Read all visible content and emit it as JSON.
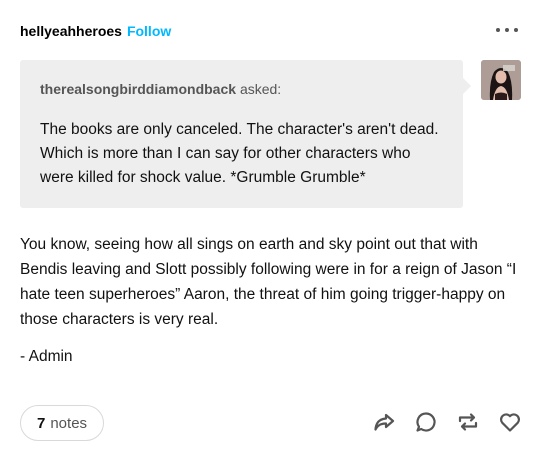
{
  "post": {
    "blog_name": "hellyeahheroes",
    "follow_label": "Follow",
    "more_icon": "more-horizontal-icon"
  },
  "ask": {
    "asker": "therealsongbirddiamondback",
    "asked_label": "asked:",
    "question": "The books are only canceled.  The character's aren't dead.  Which is more than I can say for other characters who were killed for shock value. *Grumble Grumble*"
  },
  "answer": {
    "body": "You know, seeing how all sings on earth and sky point out that with Bendis leaving and Slott possibly following were in for a reign of Jason “I hate teen superheroes” Aaron, the threat of him going trigger-happy on those characters is very real.",
    "signature": "- Admin"
  },
  "footer": {
    "notes_count": "7",
    "notes_label": "notes",
    "icons": [
      "share-icon",
      "reply-icon",
      "reblog-icon",
      "like-icon"
    ],
    "icon_color": "#555555"
  },
  "colors": {
    "follow": "#00b8ff",
    "ask_background": "#eeeeee"
  }
}
